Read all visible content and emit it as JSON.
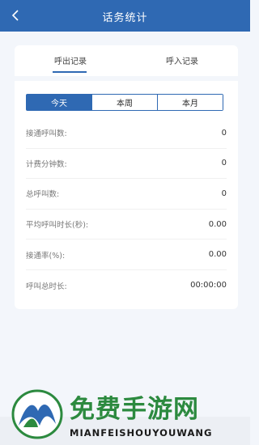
{
  "header": {
    "title": "话务统计",
    "back_icon": "chevron-left-icon"
  },
  "tabs": [
    {
      "label": "呼出记录",
      "active": true
    },
    {
      "label": "呼入记录",
      "active": false
    }
  ],
  "periods": [
    {
      "label": "今天",
      "selected": true
    },
    {
      "label": "本周",
      "selected": false
    },
    {
      "label": "本月",
      "selected": false
    }
  ],
  "stats": [
    {
      "label": "接通呼叫数:",
      "value": "0"
    },
    {
      "label": "计费分钟数:",
      "value": "0"
    },
    {
      "label": "总呼叫数:",
      "value": "0"
    },
    {
      "label": "平均呼叫时长(秒):",
      "value": "0.00"
    },
    {
      "label": "接通率(%):",
      "value": "0.00"
    },
    {
      "label": "呼叫总时长:",
      "value": "00:00:00"
    }
  ],
  "watermark": {
    "title": "免费手游网",
    "subtitle": "MIANFEISHOUYOUWANG"
  },
  "colors": {
    "accent": "#2f69b3",
    "background": "#f3f6fb",
    "watermark_green": "#2c8a3f"
  }
}
